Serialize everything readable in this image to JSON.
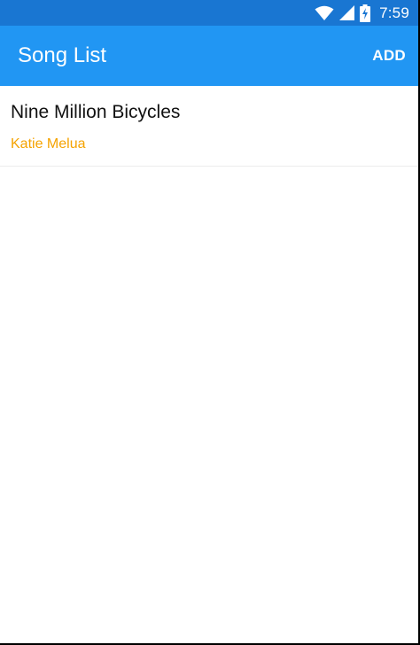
{
  "status_bar": {
    "time": "7:59",
    "icons": [
      "wifi-icon",
      "cell-signal-icon",
      "battery-charging-icon"
    ],
    "background": "#1976d2"
  },
  "app_bar": {
    "title": "Song List",
    "action_label": "ADD",
    "background": "#2196f3"
  },
  "songs": [
    {
      "title": "Nine Million Bicycles",
      "artist": "Katie Melua"
    }
  ],
  "colors": {
    "artist_text": "#f5a300"
  }
}
